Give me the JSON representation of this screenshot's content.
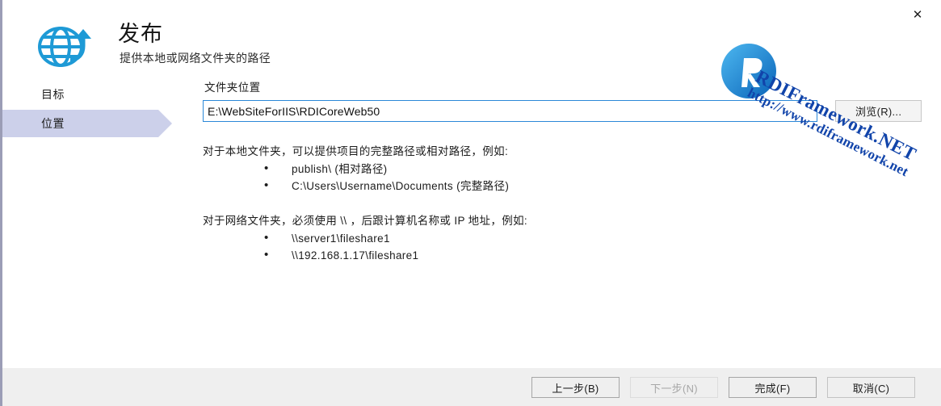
{
  "window": {
    "close_label": "✕"
  },
  "header": {
    "icon": "globe-publish-icon",
    "title": "发布",
    "subtitle": "提供本地或网络文件夹的路径"
  },
  "sidebar": {
    "items": [
      {
        "label": "目标",
        "selected": false
      },
      {
        "label": "位置",
        "selected": true
      }
    ]
  },
  "main": {
    "field_label": "文件夹位置",
    "path_value": "E:\\WebSiteForIIS\\RDICoreWeb50",
    "path_placeholder": "",
    "browse_label": "浏览(R)...",
    "description": {
      "local_intro": "对于本地文件夹，可以提供项目的完整路径或相对路径，例如:",
      "local_items": [
        "publish\\ (相对路径)",
        "C:\\Users\\Username\\Documents (完整路径)"
      ],
      "network_intro": "对于网络文件夹，必须使用 \\\\ ，后跟计算机名称或 IP 地址，例如:",
      "network_items": [
        "\\\\server1\\fileshare1",
        "\\\\192.168.1.17\\fileshare1"
      ]
    }
  },
  "watermark": {
    "logo": "rdi-r-logo-icon",
    "line1": "RDIFramework.NET",
    "line2": "http://www.rdiframework.net"
  },
  "footer": {
    "buttons": [
      {
        "label": "上一步(B)",
        "state": "default"
      },
      {
        "label": "下一步(N)",
        "state": "disabled"
      },
      {
        "label": "完成(F)",
        "state": "default"
      },
      {
        "label": "取消(C)",
        "state": "normal"
      }
    ]
  },
  "colors": {
    "accent": "#2b88d8",
    "selected_nav": "#ccd0ea",
    "footer_bg": "#efefef",
    "watermark_blue": "#1144aa",
    "icon_blue": "#1e9ad6"
  }
}
